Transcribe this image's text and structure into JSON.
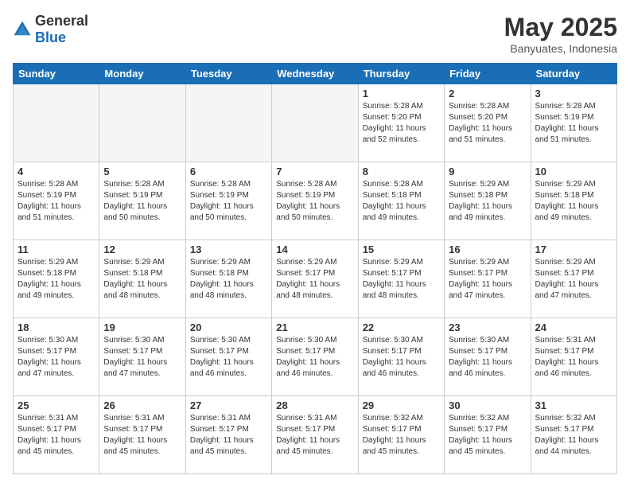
{
  "header": {
    "logo_general": "General",
    "logo_blue": "Blue",
    "month_year": "May 2025",
    "location": "Banyuates, Indonesia"
  },
  "weekdays": [
    "Sunday",
    "Monday",
    "Tuesday",
    "Wednesday",
    "Thursday",
    "Friday",
    "Saturday"
  ],
  "weeks": [
    [
      {
        "day": "",
        "empty": true
      },
      {
        "day": "",
        "empty": true
      },
      {
        "day": "",
        "empty": true
      },
      {
        "day": "",
        "empty": true
      },
      {
        "day": "1",
        "sunrise": "5:28 AM",
        "sunset": "5:20 PM",
        "daylight": "11 hours and 52 minutes."
      },
      {
        "day": "2",
        "sunrise": "5:28 AM",
        "sunset": "5:20 PM",
        "daylight": "11 hours and 51 minutes."
      },
      {
        "day": "3",
        "sunrise": "5:28 AM",
        "sunset": "5:19 PM",
        "daylight": "11 hours and 51 minutes."
      }
    ],
    [
      {
        "day": "4",
        "sunrise": "5:28 AM",
        "sunset": "5:19 PM",
        "daylight": "11 hours and 51 minutes."
      },
      {
        "day": "5",
        "sunrise": "5:28 AM",
        "sunset": "5:19 PM",
        "daylight": "11 hours and 50 minutes."
      },
      {
        "day": "6",
        "sunrise": "5:28 AM",
        "sunset": "5:19 PM",
        "daylight": "11 hours and 50 minutes."
      },
      {
        "day": "7",
        "sunrise": "5:28 AM",
        "sunset": "5:19 PM",
        "daylight": "11 hours and 50 minutes."
      },
      {
        "day": "8",
        "sunrise": "5:28 AM",
        "sunset": "5:18 PM",
        "daylight": "11 hours and 49 minutes."
      },
      {
        "day": "9",
        "sunrise": "5:29 AM",
        "sunset": "5:18 PM",
        "daylight": "11 hours and 49 minutes."
      },
      {
        "day": "10",
        "sunrise": "5:29 AM",
        "sunset": "5:18 PM",
        "daylight": "11 hours and 49 minutes."
      }
    ],
    [
      {
        "day": "11",
        "sunrise": "5:29 AM",
        "sunset": "5:18 PM",
        "daylight": "11 hours and 49 minutes."
      },
      {
        "day": "12",
        "sunrise": "5:29 AM",
        "sunset": "5:18 PM",
        "daylight": "11 hours and 48 minutes."
      },
      {
        "day": "13",
        "sunrise": "5:29 AM",
        "sunset": "5:18 PM",
        "daylight": "11 hours and 48 minutes."
      },
      {
        "day": "14",
        "sunrise": "5:29 AM",
        "sunset": "5:17 PM",
        "daylight": "11 hours and 48 minutes."
      },
      {
        "day": "15",
        "sunrise": "5:29 AM",
        "sunset": "5:17 PM",
        "daylight": "11 hours and 48 minutes."
      },
      {
        "day": "16",
        "sunrise": "5:29 AM",
        "sunset": "5:17 PM",
        "daylight": "11 hours and 47 minutes."
      },
      {
        "day": "17",
        "sunrise": "5:29 AM",
        "sunset": "5:17 PM",
        "daylight": "11 hours and 47 minutes."
      }
    ],
    [
      {
        "day": "18",
        "sunrise": "5:30 AM",
        "sunset": "5:17 PM",
        "daylight": "11 hours and 47 minutes."
      },
      {
        "day": "19",
        "sunrise": "5:30 AM",
        "sunset": "5:17 PM",
        "daylight": "11 hours and 47 minutes."
      },
      {
        "day": "20",
        "sunrise": "5:30 AM",
        "sunset": "5:17 PM",
        "daylight": "11 hours and 46 minutes."
      },
      {
        "day": "21",
        "sunrise": "5:30 AM",
        "sunset": "5:17 PM",
        "daylight": "11 hours and 46 minutes."
      },
      {
        "day": "22",
        "sunrise": "5:30 AM",
        "sunset": "5:17 PM",
        "daylight": "11 hours and 46 minutes."
      },
      {
        "day": "23",
        "sunrise": "5:30 AM",
        "sunset": "5:17 PM",
        "daylight": "11 hours and 46 minutes."
      },
      {
        "day": "24",
        "sunrise": "5:31 AM",
        "sunset": "5:17 PM",
        "daylight": "11 hours and 46 minutes."
      }
    ],
    [
      {
        "day": "25",
        "sunrise": "5:31 AM",
        "sunset": "5:17 PM",
        "daylight": "11 hours and 45 minutes."
      },
      {
        "day": "26",
        "sunrise": "5:31 AM",
        "sunset": "5:17 PM",
        "daylight": "11 hours and 45 minutes."
      },
      {
        "day": "27",
        "sunrise": "5:31 AM",
        "sunset": "5:17 PM",
        "daylight": "11 hours and 45 minutes."
      },
      {
        "day": "28",
        "sunrise": "5:31 AM",
        "sunset": "5:17 PM",
        "daylight": "11 hours and 45 minutes."
      },
      {
        "day": "29",
        "sunrise": "5:32 AM",
        "sunset": "5:17 PM",
        "daylight": "11 hours and 45 minutes."
      },
      {
        "day": "30",
        "sunrise": "5:32 AM",
        "sunset": "5:17 PM",
        "daylight": "11 hours and 45 minutes."
      },
      {
        "day": "31",
        "sunrise": "5:32 AM",
        "sunset": "5:17 PM",
        "daylight": "11 hours and 44 minutes."
      }
    ]
  ]
}
